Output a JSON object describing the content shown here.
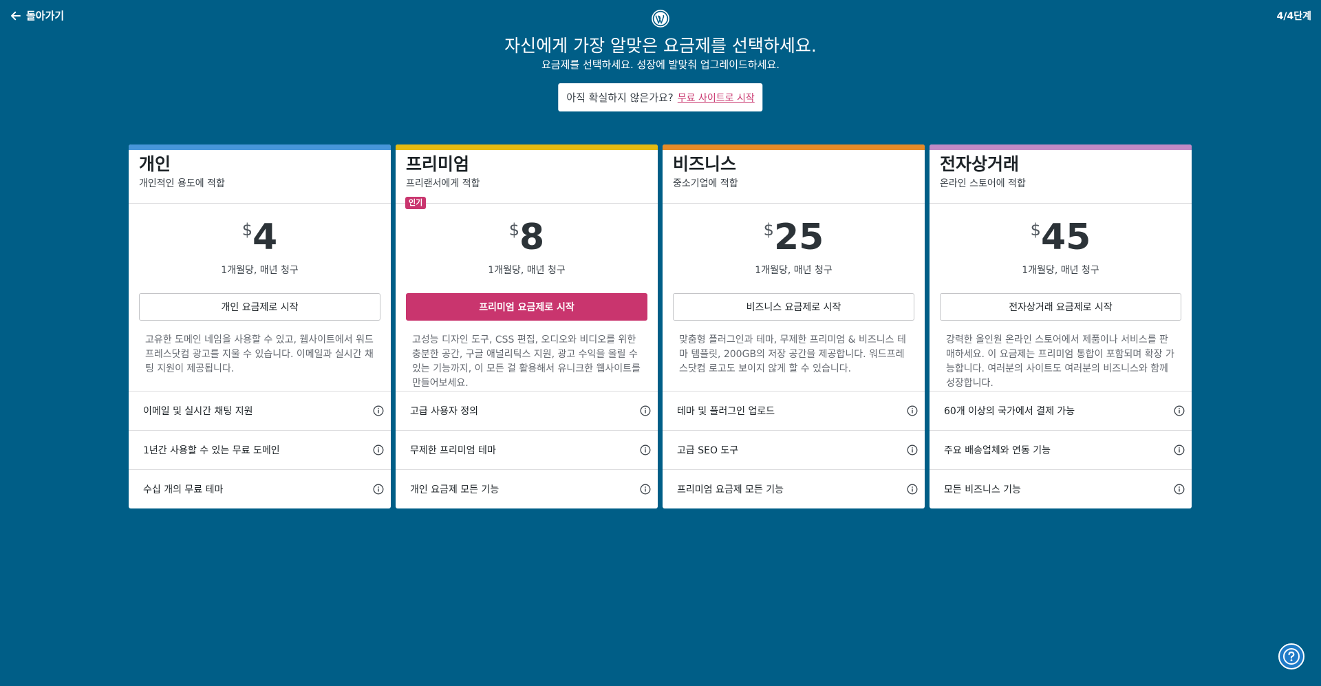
{
  "nav": {
    "back_label": "돌아가기",
    "step": "4/4단계"
  },
  "header": {
    "title": "자신에게 가장 알맞은 요금제를 선택하세요.",
    "subtitle": "요금제를 선택하세요. 성장에 발맞춰 업그레이드하세요."
  },
  "notice": {
    "text": "아직 확실하지 않은가요?",
    "link": "무료 사이트로 시작"
  },
  "colors": {
    "background": "#005e87",
    "primary": "#c9356e"
  },
  "plans": [
    {
      "name": "개인",
      "tagline": "개인적인 용도에 적합",
      "accent": "#4796da",
      "currency": "$",
      "price": "4",
      "period": "1개월당, 매년 청구",
      "cta": "개인 요금제로 시작",
      "description": "고유한 도메인 네임을 사용할 수 있고, 웹사이트에서 워드프레스닷컴 광고를 지울 수 있습니다. 이메일과 실시간 채팅 지원이 제공됩니다.",
      "features": [
        "이메일 및 실시간 채팅 지원",
        "1년간 사용할 수 있는 무료 도메인",
        "수십 개의 무료 테마"
      ]
    },
    {
      "name": "프리미엄",
      "tagline": "프리랜서에게 적합",
      "accent": "#e4bb11",
      "badge": "인기",
      "currency": "$",
      "price": "8",
      "period": "1개월당, 매년 청구",
      "cta": "프리미엄 요금제로 시작",
      "description": "고성능 디자인 도구, CSS 편집, 오디오와 비디오를 위한 충분한 공간, 구글 애널리틱스 지원, 광고 수익을 올릴 수 있는 기능까지, 이 모든 걸 활용해서 유니크한 웹사이트를 만들어보세요.",
      "features": [
        "고급 사용자 정의",
        "무제한 프리미엄 테마",
        "개인 요금제 모든 기능"
      ]
    },
    {
      "name": "비즈니스",
      "tagline": "중소기업에 적합",
      "accent": "#e68b28",
      "currency": "$",
      "price": "25",
      "period": "1개월당, 매년 청구",
      "cta": "비즈니스 요금제로 시작",
      "description": "맞춤형 플러그인과 테마, 무제한 프리미엄 & 비즈니스 테마 템플릿, 200GB의 저장 공간을 제공합니다. 워드프레스닷컴 로고도 보이지 않게 할 수 있습니다.",
      "features": [
        "테마 및 플러그인 업로드",
        "고급 SEO 도구",
        "프리미엄 요금제 모든 기능"
      ]
    },
    {
      "name": "전자상거래",
      "tagline": "온라인 스토어에 적합",
      "accent": "#c18ac6",
      "currency": "$",
      "price": "45",
      "period": "1개월당, 매년 청구",
      "cta": "전자상거래 요금제로 시작",
      "description": "강력한 올인원 온라인 스토어에서 제품이나 서비스를 판매하세요. 이 요금제는 프리미엄 통합이 포함되며 확장 가능합니다. 여러분의 사이트도 여러분의 비즈니스와 함께 성장합니다.",
      "features": [
        "60개 이상의 국가에서 결제 가능",
        "주요 배송업체와 연동 기능",
        "모든 비즈니스 기능"
      ]
    }
  ],
  "icons": {
    "back": "arrow-left-icon",
    "logo": "wordpress-logo",
    "info": "info-icon",
    "help": "help-icon"
  }
}
